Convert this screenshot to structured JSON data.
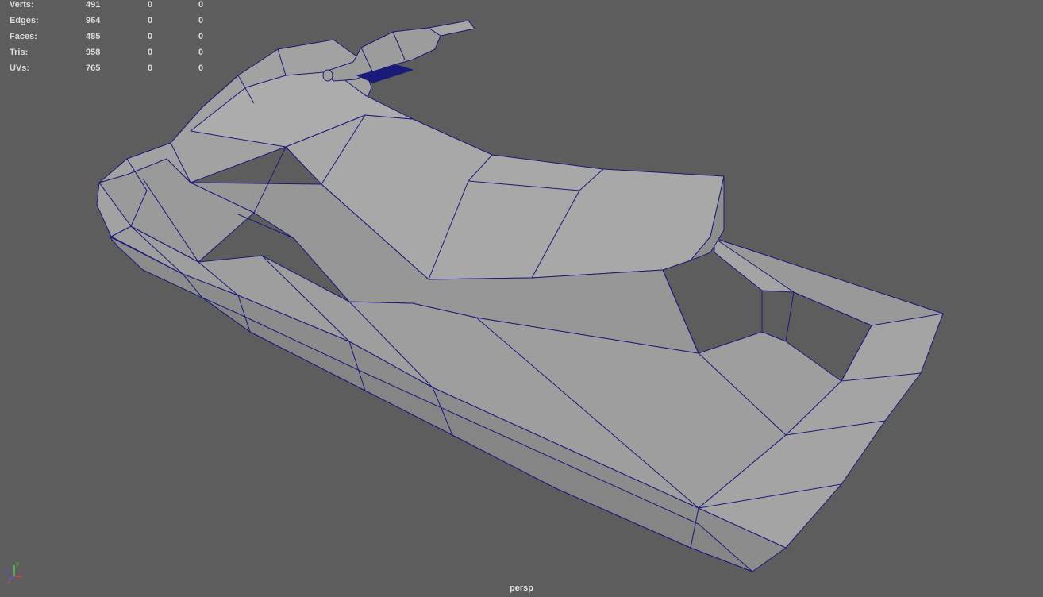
{
  "hud": {
    "rows": [
      {
        "label": "Verts:",
        "v1": "491",
        "v2": "0",
        "v3": "0"
      },
      {
        "label": "Edges:",
        "v1": "964",
        "v2": "0",
        "v3": "0"
      },
      {
        "label": "Faces:",
        "v1": "485",
        "v2": "0",
        "v3": "0"
      },
      {
        "label": "Tris:",
        "v1": "958",
        "v2": "0",
        "v3": "0"
      },
      {
        "label": "UVs:",
        "v1": "765",
        "v2": "0",
        "v3": "0"
      }
    ]
  },
  "viewport": {
    "camera_name": "persp",
    "background_color": "#5d5d5d",
    "wireframe_color": "#1a1a7a",
    "face_color": "#a0a0a0"
  },
  "axis_gizmo": {
    "x_label": "x",
    "y_label": "y",
    "z_label": "z",
    "x_color": "#e04040",
    "y_color": "#40d040",
    "z_color": "#4060ff"
  }
}
